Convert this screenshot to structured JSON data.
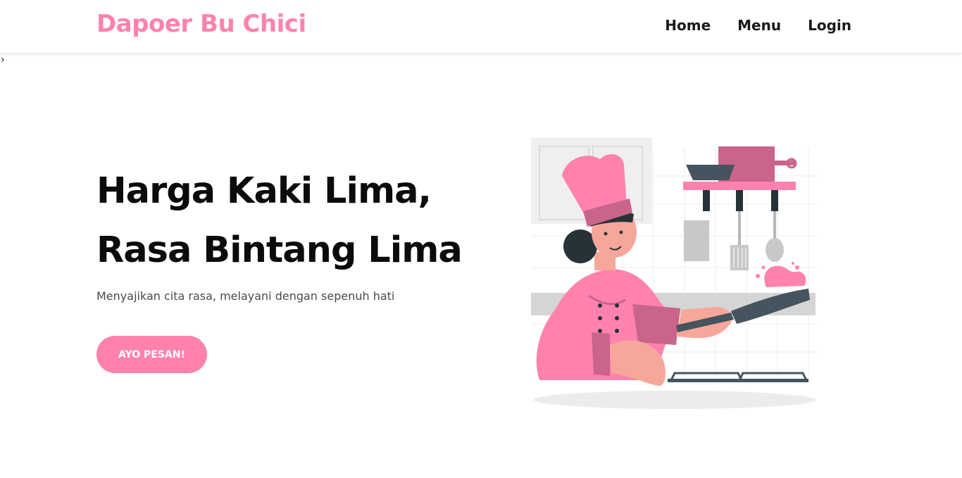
{
  "header": {
    "brand": "Dapoer Bu Chici",
    "nav": [
      {
        "label": "Home"
      },
      {
        "label": "Menu"
      },
      {
        "label": "Login"
      }
    ]
  },
  "stray_text": "›",
  "hero": {
    "title_lines": [
      "Harga Kaki Lima,",
      "Rasa Bintang Lima"
    ],
    "subtitle": "Menyajikan cita rasa, melayani dengan sepenuh hati",
    "cta_label": "AYO PESAN!"
  },
  "illustration": {
    "icon": "chef-cooking-illustration",
    "colors": {
      "accent": "#ff82ae",
      "accent_dark": "#c9648a",
      "pan": "#45545e",
      "skin": "#f7a79a",
      "hair": "#263238",
      "grey": "#c8c8c8"
    }
  },
  "theme": {
    "primary": "#ff82ae",
    "text_dark": "#111111",
    "text_muted": "#4a4a4a"
  }
}
